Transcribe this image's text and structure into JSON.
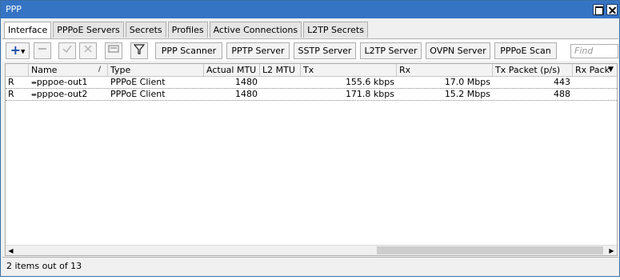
{
  "window": {
    "title": "PPP"
  },
  "tabs": [
    {
      "label": "Interface"
    },
    {
      "label": "PPPoE Servers"
    },
    {
      "label": "Secrets"
    },
    {
      "label": "Profiles"
    },
    {
      "label": "Active Connections"
    },
    {
      "label": "L2TP Secrets"
    }
  ],
  "toolbar": {
    "add_icon": "plus-icon",
    "buttons": [
      {
        "label": "PPP Scanner"
      },
      {
        "label": "PPTP Server"
      },
      {
        "label": "SSTP Server"
      },
      {
        "label": "L2TP Server"
      },
      {
        "label": "OVPN Server"
      },
      {
        "label": "PPPoE Scan"
      }
    ],
    "find_placeholder": "Find"
  },
  "table": {
    "columns": [
      "",
      "Name",
      "Type",
      "Actual MTU",
      "L2 MTU",
      "Tx",
      "Rx",
      "Tx Packet (p/s)",
      "Rx Pack"
    ],
    "rows": [
      {
        "flag": "R",
        "name": "pppoe-out1",
        "type": "PPPoE Client",
        "actual_mtu": "1480",
        "l2_mtu": "",
        "tx": "155.6 kbps",
        "rx": "17.0 Mbps",
        "tx_packet": "443",
        "rx_packet": ""
      },
      {
        "flag": "R",
        "name": "pppoe-out2",
        "type": "PPPoE Client",
        "actual_mtu": "1480",
        "l2_mtu": "",
        "tx": "171.8 kbps",
        "rx": "15.2 Mbps",
        "tx_packet": "488",
        "rx_packet": ""
      }
    ]
  },
  "status": {
    "text": "2 items out of 13"
  },
  "colors": {
    "titlebar": "#3574c4",
    "accent": "#1f4fa8"
  }
}
